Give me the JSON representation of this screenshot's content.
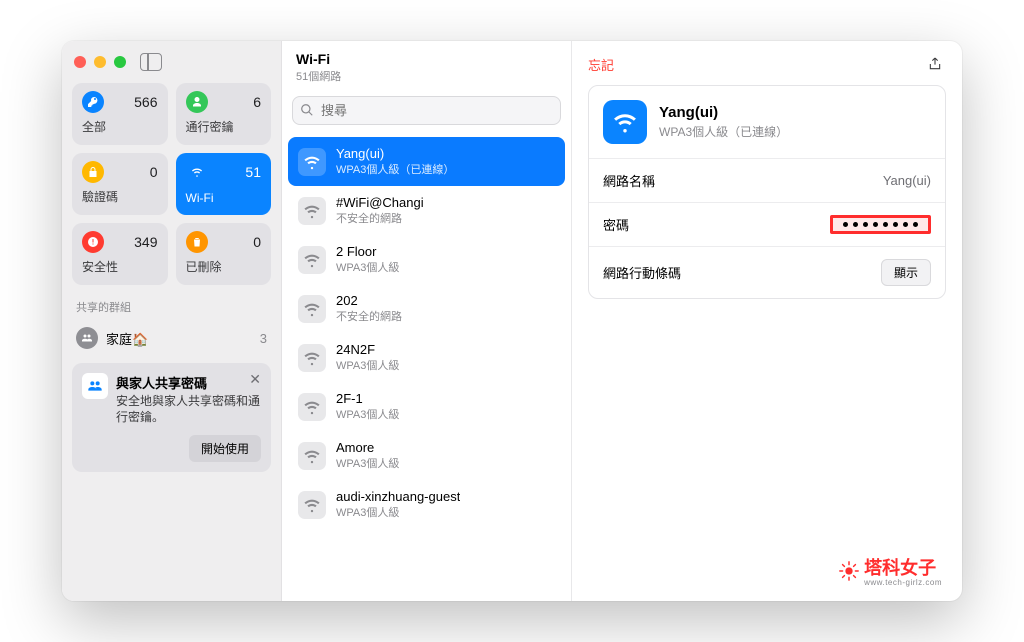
{
  "sidebar": {
    "categories": [
      {
        "label": "全部",
        "count": "566",
        "color": "#0a84ff",
        "icon": "key"
      },
      {
        "label": "通行密鑰",
        "count": "6",
        "color": "#34c759",
        "icon": "person"
      },
      {
        "label": "驗證碼",
        "count": "0",
        "color": "#ffb800",
        "icon": "lock"
      },
      {
        "label": "Wi-Fi",
        "count": "51",
        "color": "#0a84ff",
        "icon": "wifi",
        "active": true
      },
      {
        "label": "安全性",
        "count": "349",
        "color": "#ff3b30",
        "icon": "alert"
      },
      {
        "label": "已刪除",
        "count": "0",
        "color": "#ff9500",
        "icon": "trash"
      }
    ],
    "sharedGroupsLabel": "共享的群組",
    "group": {
      "label": "家庭🏠",
      "count": "3"
    },
    "shareCard": {
      "title": "與家人共享密碼",
      "subtitle": "安全地與家人共享密碼和通行密鑰。",
      "button": "開始使用"
    }
  },
  "mid": {
    "title": "Wi-Fi",
    "subtitle": "51個網路",
    "searchPlaceholder": "搜尋",
    "networks": [
      {
        "name": "Yang(ui)",
        "sub": "WPA3個人級（已連線）",
        "selected": true
      },
      {
        "name": "#WiFi@Changi",
        "sub": "不安全的網路"
      },
      {
        "name": "2 Floor",
        "sub": "WPA3個人級"
      },
      {
        "name": "202",
        "sub": "不安全的網路"
      },
      {
        "name": "24N2F",
        "sub": "WPA3個人級"
      },
      {
        "name": "2F-1",
        "sub": "WPA3個人級"
      },
      {
        "name": "Amore",
        "sub": "WPA3個人級"
      },
      {
        "name": "audi-xinzhuang-guest",
        "sub": "WPA3個人級"
      }
    ]
  },
  "detail": {
    "forget": "忘記",
    "hero": {
      "title": "Yang(ui)",
      "subtitle": "WPA3個人級（已連線）"
    },
    "rows": {
      "networkNameLabel": "網路名稱",
      "networkNameValue": "Yang(ui)",
      "passwordLabel": "密碼",
      "qrLabel": "網路行動條碼",
      "qrButton": "顯示"
    }
  },
  "watermark": {
    "text": "塔科女子",
    "sub": "www.tech-girlz.com"
  }
}
